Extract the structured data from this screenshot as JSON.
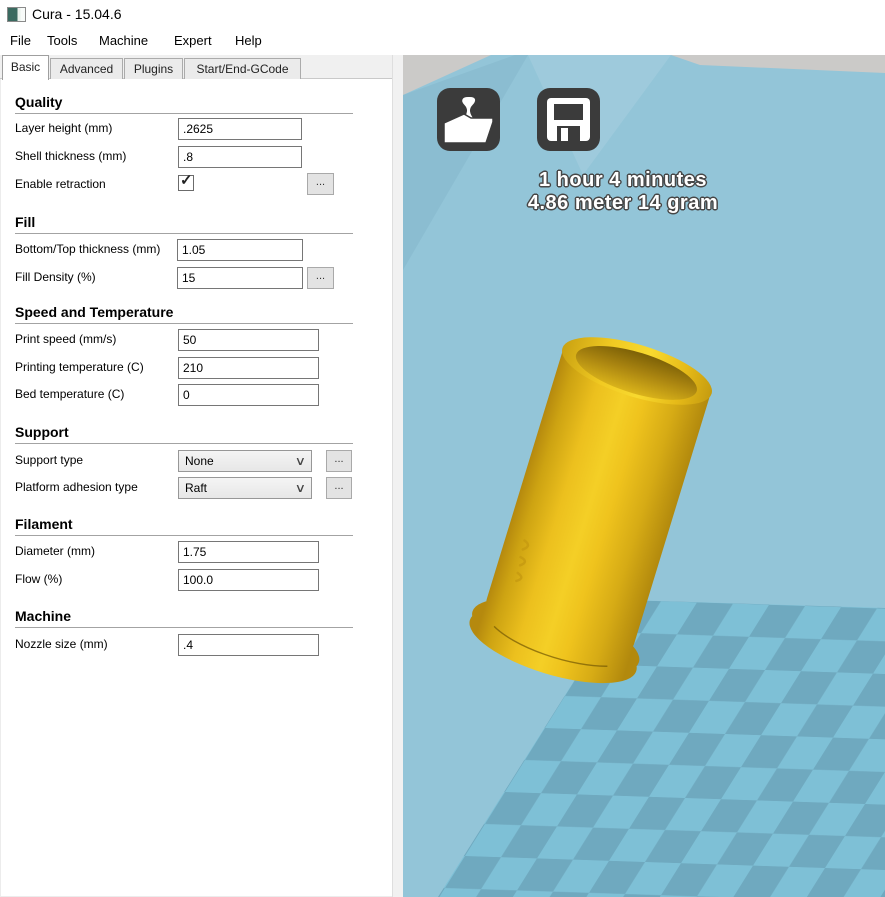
{
  "window": {
    "title": "Cura - 15.04.6"
  },
  "menu": {
    "items": [
      "File",
      "Tools",
      "Machine",
      "Expert",
      "Help"
    ]
  },
  "tabs": {
    "items": [
      "Basic",
      "Advanced",
      "Plugins",
      "Start/End-GCode"
    ],
    "active": "Basic"
  },
  "icons": {
    "check": "✓",
    "chevron_down": "∨",
    "ellipsis": "..."
  },
  "settings": {
    "quality": {
      "title": "Quality",
      "layer_height": {
        "label": "Layer height (mm)",
        "value": ".2625"
      },
      "shell_thickness": {
        "label": "Shell thickness (mm)",
        "value": ".8"
      },
      "enable_retraction": {
        "label": "Enable retraction",
        "checked": true
      }
    },
    "fill": {
      "title": "Fill",
      "bottom_top_thickness": {
        "label": "Bottom/Top thickness (mm)",
        "value": "1.05"
      },
      "fill_density": {
        "label": "Fill Density (%)",
        "value": "15"
      }
    },
    "speed_temperature": {
      "title": "Speed and Temperature",
      "print_speed": {
        "label": "Print speed (mm/s)",
        "value": "50"
      },
      "printing_temperature": {
        "label": "Printing temperature (C)",
        "value": "210"
      },
      "bed_temperature": {
        "label": "Bed temperature (C)",
        "value": "0"
      }
    },
    "support": {
      "title": "Support",
      "support_type": {
        "label": "Support type",
        "value": "None"
      },
      "platform_adhesion_type": {
        "label": "Platform adhesion type",
        "value": "Raft"
      }
    },
    "filament": {
      "title": "Filament",
      "diameter": {
        "label": "Diameter (mm)",
        "value": "1.75"
      },
      "flow": {
        "label": "Flow (%)",
        "value": "100.0"
      }
    },
    "machine": {
      "title": "Machine",
      "nozzle_size": {
        "label": "Nozzle size (mm)",
        "value": ".4"
      }
    }
  },
  "viewport": {
    "print_time": "1 hour 4 minutes",
    "material_usage": "4.86 meter 14 gram",
    "colors": {
      "background": "#93c5d8",
      "background_gray": "#cbcac8",
      "checker_light": "#7ec0d6",
      "checker_dark": "#6fa9bf",
      "model_yellow": "#f2cd24",
      "button_bg": "#3b3b3b"
    }
  }
}
